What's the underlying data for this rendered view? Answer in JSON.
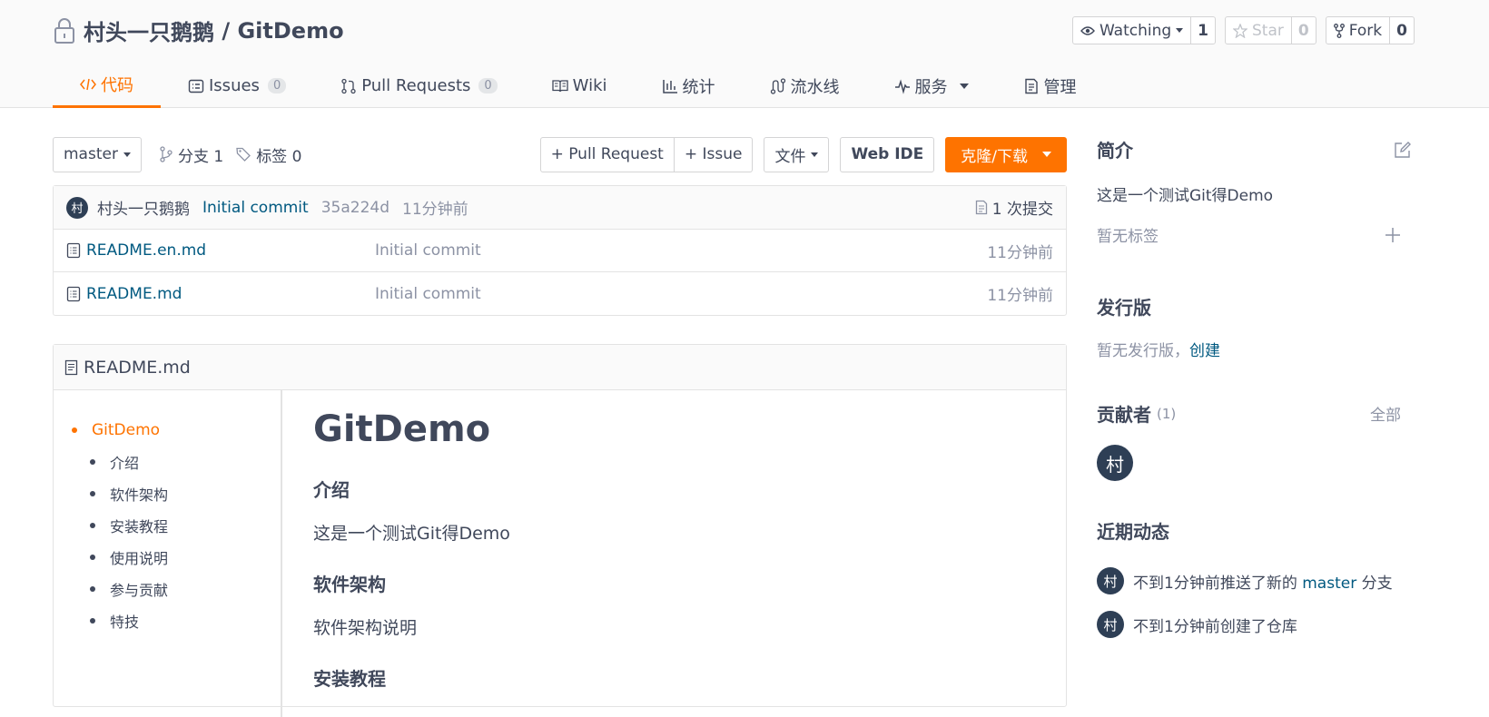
{
  "repo": {
    "owner": "村头一只鹅鹅",
    "separator": " / ",
    "name": "GitDemo"
  },
  "actions": {
    "watch": {
      "label": "Watching",
      "count": "1"
    },
    "star": {
      "label": "Star",
      "count": "0"
    },
    "fork": {
      "label": "Fork",
      "count": "0"
    }
  },
  "tabs": [
    {
      "label": "代码",
      "icon": "code-icon"
    },
    {
      "label": "Issues",
      "badge": "0",
      "icon": "issues-icon"
    },
    {
      "label": "Pull Requests",
      "badge": "0",
      "icon": "pull-request-icon"
    },
    {
      "label": "Wiki",
      "icon": "book-icon"
    },
    {
      "label": "统计",
      "icon": "chart-icon"
    },
    {
      "label": "流水线",
      "icon": "pipeline-icon"
    },
    {
      "label": "服务",
      "icon": "pulse-icon"
    },
    {
      "label": "管理",
      "icon": "settings-doc-icon"
    }
  ],
  "branch_bar": {
    "branch": "master",
    "branches": "分支 1",
    "tags": "标签 0",
    "pull_request": "+ Pull Request",
    "issue": "+ Issue",
    "file": "文件",
    "web_ide": "Web IDE",
    "clone": "克隆/下载"
  },
  "commit": {
    "avatar": "村",
    "author": "村头一只鹅鹅",
    "message": "Initial commit",
    "hash": "35a224d",
    "time": "11分钟前",
    "count": "1 次提交"
  },
  "files": [
    {
      "name": "README.en.md",
      "message": "Initial commit",
      "time": "11分钟前"
    },
    {
      "name": "README.md",
      "message": "Initial commit",
      "time": "11分钟前"
    }
  ],
  "readme": {
    "filename": "README.md",
    "toc": [
      "GitDemo",
      "介绍",
      "软件架构",
      "安装教程",
      "使用说明",
      "参与贡献",
      "特技"
    ],
    "h1": "GitDemo",
    "intro_heading": "介绍",
    "intro_text": "这是一个测试Git得Demo",
    "arch_heading": "软件架构",
    "arch_text": "软件架构说明",
    "install_heading": "安装教程"
  },
  "sidebar": {
    "about_title": "简介",
    "about_text": "这是一个测试Git得Demo",
    "no_tags": "暂无标签",
    "releases_title": "发行版",
    "no_release": "暂无发行版，",
    "create_link": "创建",
    "contributors_title": "贡献者",
    "contributors_count": "(1)",
    "all_link": "全部",
    "contributor_avatar": "村",
    "activity_title": "近期动态",
    "activity": [
      {
        "avatar": "村",
        "before": "不到1分钟前推送了新的 ",
        "link": "master",
        "after": " 分支"
      },
      {
        "avatar": "村",
        "before": "不到1分钟前创建了仓库",
        "link": "",
        "after": ""
      }
    ]
  },
  "colors": {
    "accent": "#fe7300",
    "link": "#005980",
    "text": "#40485b",
    "muted": "#8c92a4",
    "avatar": "#2e3f55"
  }
}
